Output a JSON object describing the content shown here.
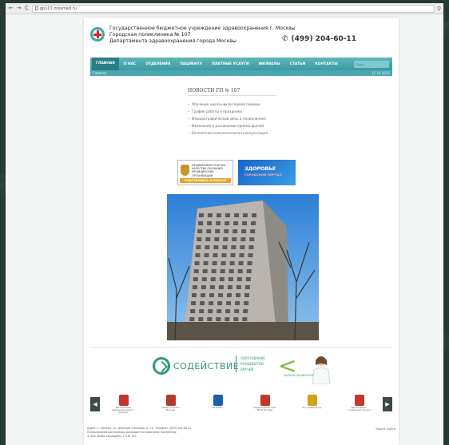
{
  "browser": {
    "back_glyph": "←",
    "forward_glyph": "→",
    "reload_glyph": "C",
    "url_icon": "page-icon",
    "url": "gp107.mosmed.ru",
    "search_glyph": "⚲"
  },
  "header": {
    "org_line1": "Государственное бюджетное учреждение здравоохранения г. Москвы",
    "org_line2": "Городская поликлиника № 107",
    "org_line3": "Департамента здравоохранения города Москвы",
    "phone": "(499) 204-60-11",
    "phone_icon": "phone-icon"
  },
  "nav": {
    "items": [
      {
        "label": "ГЛАВНАЯ",
        "active": true
      },
      {
        "label": "О НАС",
        "active": false
      },
      {
        "label": "ОТДЕЛЕНИЯ",
        "active": false
      },
      {
        "label": "ПАЦИЕНТУ",
        "active": false
      },
      {
        "label": "ПЛАТНЫЕ УСЛУГИ",
        "active": false
      },
      {
        "label": "ФИЛИАЛЫ",
        "active": false
      },
      {
        "label": "СТАТЬИ",
        "active": false
      },
      {
        "label": "КОНТАКТЫ",
        "active": false
      }
    ],
    "search_placeholder": "Поиск...",
    "breadcrumb": "Главная",
    "date": "11.10.2015"
  },
  "news": {
    "title": "НОВОСТИ ГП № 107",
    "items": [
      "Обучение школьников первой помощи",
      "График работы в праздники",
      "Флюорографический день в поликлинике",
      "Изменения в расписании приема врачей",
      "Бесплатная онкологическая консультация"
    ]
  },
  "banners": {
    "gov_text": "НЕЗАВИСИМАЯ ОЦЕНКА КАЧЕСТВА ОКАЗАНИЯ МЕДИЦИНСКИХ ОРГАНИЗАЦИЙ",
    "gov_button": "УЧАСТВОВАТЬ В ОПРОСЕ",
    "health_title": "ЗДОРОВЬЕ",
    "health_sub": "ГОРОДСКОЙ ПОРТАЛ"
  },
  "sodeystvie": {
    "name": "СОДЕЙСТВИЕ",
    "desc_line1": "ОБРАЗОВАНИЕ",
    "desc_line2": "КАНДИДАТОВ",
    "desc_line3": "ВРАЧЕЙ",
    "small": "ЗАПИСЬ ПАЦИЕНТОВ"
  },
  "carousel": {
    "prev_glyph": "◀",
    "next_glyph": "▶",
    "items": [
      {
        "icon": "coat-of-arms-icon",
        "color": "#c0392b",
        "label": "Департамент здравоохранения г. Москвы"
      },
      {
        "icon": "kremlin-icon",
        "color": "#b03a2e",
        "label": "Правительство Москвы"
      },
      {
        "icon": "mgfoms-icon",
        "color": "#1d5fa6",
        "label": "МГФОМС"
      },
      {
        "icon": "coat-of-arms-icon",
        "color": "#c0392b",
        "label": "Официальный сайт Мэра Москвы"
      },
      {
        "icon": "emblem-icon",
        "color": "#d4a017",
        "label": "Росздравнадзор"
      },
      {
        "icon": "coat-of-arms-icon",
        "color": "#c0392b",
        "label": "Департамент социальной защиты"
      }
    ]
  },
  "footer": {
    "line1": "Адрес: г. Москва, ул. Дмитрия Ульянова, д. 29, Телефон: (499) 204-60-11",
    "line2": "Поликлиническая помощь оказывается взрослому населению",
    "line3": "© Все права защищены, ГП № 107",
    "right": "Карта сайта"
  },
  "colors": {
    "nav_bg": "#3a9aa2",
    "accent_green": "#2f9a6f",
    "health_blue": "#1b63c6"
  }
}
